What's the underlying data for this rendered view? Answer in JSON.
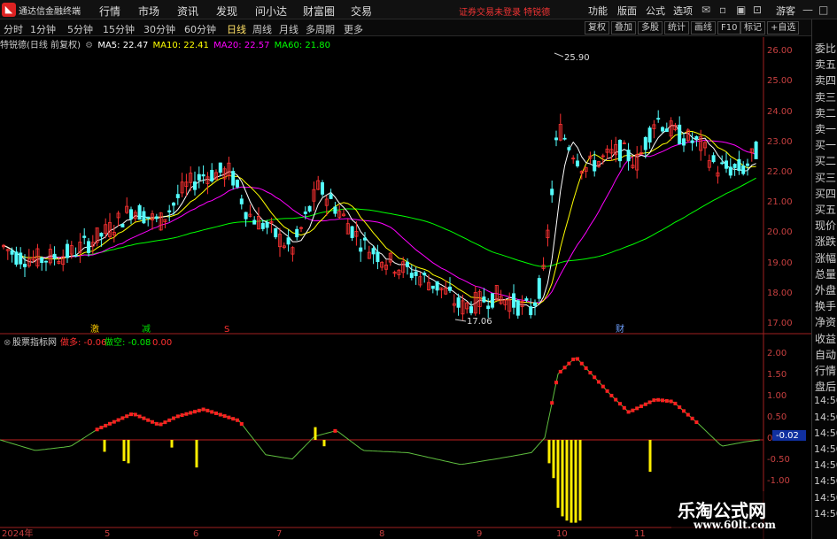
{
  "menubar": {
    "app_name": "通达信金融终端",
    "items": [
      "行情",
      "市场",
      "资讯",
      "发现",
      "问小达",
      "财富圈",
      "交易"
    ],
    "notice": "证券交易未登录  特锐德",
    "tools": [
      "功能",
      "版面",
      "公式",
      "选项"
    ],
    "account": "游客"
  },
  "tabs": {
    "periods": [
      "分时",
      "1分钟",
      "5分钟",
      "15分钟",
      "30分钟",
      "60分钟",
      "日线",
      "周线",
      "月线",
      "多周期",
      "更多"
    ],
    "active": "日线",
    "right_tools": [
      "复权",
      "叠加",
      "多股",
      "统计",
      "画线",
      "F10",
      "标记",
      "+自选"
    ]
  },
  "info": {
    "stock": "特锐德(日线 前复权)",
    "ma5": "MA5: 22.47",
    "ma10": "MA10: 22.41",
    "ma20": "MA20: 22.57",
    "ma60": "MA60: 21.80"
  },
  "price_axis": [
    "26.00",
    "25.00",
    "24.00",
    "23.00",
    "22.00",
    "21.00",
    "20.00",
    "19.00",
    "18.00",
    "17.00"
  ],
  "annotations": {
    "high": "25.90",
    "low": "17.06",
    "markers": [
      "激",
      "减",
      "S",
      "财"
    ]
  },
  "indicator": {
    "name": "股票指标网",
    "long_label": "做多: -0.06",
    "short_label": "做空: -0.08",
    "value": "0.00",
    "axis": [
      "2.00",
      "1.50",
      "1.00",
      "0.50",
      "0.00",
      "-0.50",
      "-1.00"
    ],
    "current": "-0.02"
  },
  "dates": [
    "2024年",
    "5",
    "6",
    "7",
    "8",
    "9",
    "10",
    "11"
  ],
  "sidebar": [
    "委比",
    "卖五",
    "卖四",
    "卖三",
    "卖二",
    "卖一",
    "买一",
    "买二",
    "买三",
    "买四",
    "买五",
    "现价",
    "涨跌",
    "涨幅",
    "总量",
    "外盘",
    "换手",
    "净资",
    "收益",
    "自动",
    "行情",
    "盘后",
    "14:50",
    "14:50",
    "14:50",
    "14:50",
    "14:50",
    "14:50",
    "14:50",
    "14:50"
  ],
  "watermark": {
    "title": "乐淘公式网",
    "url": "www.60lt.com"
  },
  "colors": {
    "up": "#ff3232",
    "down": "#54ffff",
    "ma5": "#ffffff",
    "ma10": "#ffff00",
    "ma20": "#ff00ff",
    "ma60": "#00ff00",
    "axis": "#c84040"
  }
}
